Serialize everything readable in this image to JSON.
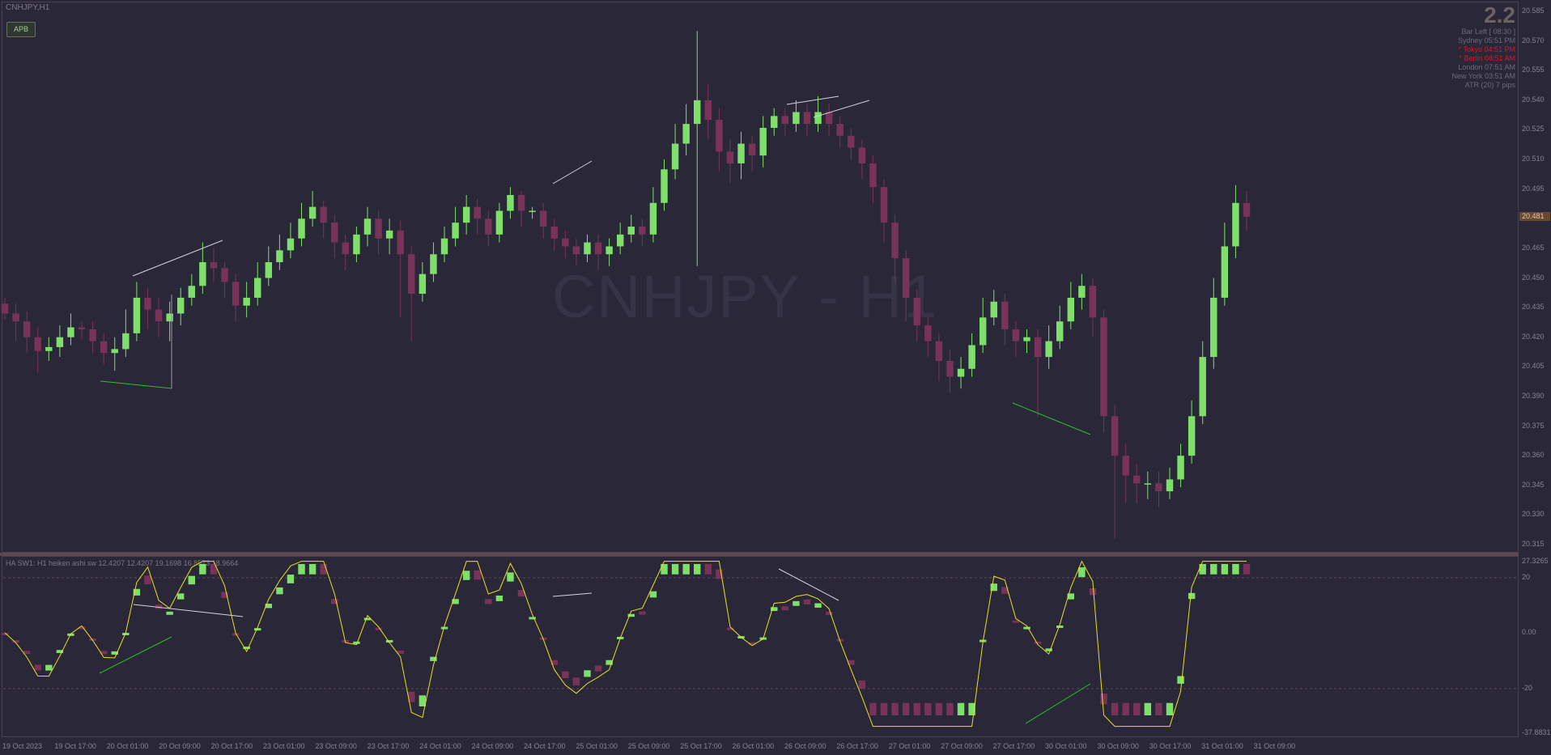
{
  "window": {
    "symbol_title": "CNHJPY,H1",
    "watermark": "CNHJPY - H1"
  },
  "buttons": {
    "apb_label": "APB"
  },
  "info_panel": {
    "spread": "2.2",
    "rows": [
      {
        "label": "Bar Left",
        "value": "[ 08:30 ]",
        "highlight": false
      },
      {
        "label": "Sydney",
        "value": "05:51 PM",
        "highlight": false
      },
      {
        "label": "* Tokyo",
        "value": "04:51 PM",
        "highlight": true
      },
      {
        "label": "* Berlin",
        "value": "08:51 AM",
        "highlight": true
      },
      {
        "label": "London",
        "value": "07:51 AM",
        "highlight": false
      },
      {
        "label": "New York",
        "value": "03:51 AM",
        "highlight": false
      },
      {
        "label": "ATR (20)",
        "value": "7 pips",
        "highlight": false
      }
    ]
  },
  "indicator": {
    "label": "HA SW1: H1 heiken ashi sw 12.4207 12.4207 19.1698 16.8573 18.9664"
  },
  "price_axis": {
    "ticks": [
      "20.585",
      "20.570",
      "20.555",
      "20.540",
      "20.525",
      "20.510",
      "20.495",
      "20.480",
      "20.465",
      "20.450",
      "20.435",
      "20.420",
      "20.405",
      "20.390",
      "20.375",
      "20.360",
      "20.345",
      "20.330",
      "20.315"
    ],
    "current": "20.481"
  },
  "indicator_axis": {
    "ticks": [
      "27.3265",
      "20",
      "0.00",
      "-20",
      "-37.8831"
    ]
  },
  "time_axis": {
    "ticks": [
      "19 Oct 2023",
      "19 Oct 17:00",
      "20 Oct 01:00",
      "20 Oct 09:00",
      "20 Oct 17:00",
      "23 Oct 01:00",
      "23 Oct 09:00",
      "23 Oct 17:00",
      "24 Oct 01:00",
      "24 Oct 09:00",
      "24 Oct 17:00",
      "25 Oct 01:00",
      "25 Oct 09:00",
      "25 Oct 17:00",
      "26 Oct 01:00",
      "26 Oct 09:00",
      "26 Oct 17:00",
      "27 Oct 01:00",
      "27 Oct 09:00",
      "27 Oct 17:00",
      "30 Oct 01:00",
      "30 Oct 09:00",
      "30 Oct 17:00",
      "31 Oct 01:00",
      "31 Oct 09:00"
    ]
  },
  "colors": {
    "background": "#2a2838",
    "bull": "#7ee06a",
    "bear": "#7a3358",
    "line": "#e8e020",
    "arrow_green": "#27c22a",
    "arrow_white": "#d6d2de"
  },
  "chart_data": {
    "type": "candlestick",
    "title": "CNHJPY - H1",
    "ylim": [
      20.315,
      20.585
    ],
    "candles": [
      {
        "o": 20.437,
        "c": 20.432,
        "h": 20.44,
        "l": 20.429
      },
      {
        "o": 20.432,
        "c": 20.428,
        "h": 20.437,
        "l": 20.418
      },
      {
        "o": 20.428,
        "c": 20.42,
        "h": 20.433,
        "l": 20.412
      },
      {
        "o": 20.42,
        "c": 20.413,
        "h": 20.425,
        "l": 20.402
      },
      {
        "o": 20.413,
        "c": 20.415,
        "h": 20.42,
        "l": 20.408
      },
      {
        "o": 20.415,
        "c": 20.42,
        "h": 20.426,
        "l": 20.41
      },
      {
        "o": 20.42,
        "c": 20.425,
        "h": 20.432,
        "l": 20.416
      },
      {
        "o": 20.425,
        "c": 20.424,
        "h": 20.428,
        "l": 20.419
      },
      {
        "o": 20.424,
        "c": 20.418,
        "h": 20.428,
        "l": 20.412
      },
      {
        "o": 20.418,
        "c": 20.412,
        "h": 20.422,
        "l": 20.406
      },
      {
        "o": 20.412,
        "c": 20.414,
        "h": 20.42,
        "l": 20.403
      },
      {
        "o": 20.414,
        "c": 20.422,
        "h": 20.434,
        "l": 20.41
      },
      {
        "o": 20.422,
        "c": 20.44,
        "h": 20.448,
        "l": 20.418
      },
      {
        "o": 20.44,
        "c": 20.434,
        "h": 20.445,
        "l": 20.424
      },
      {
        "o": 20.434,
        "c": 20.428,
        "h": 20.44,
        "l": 20.42
      },
      {
        "o": 20.428,
        "c": 20.432,
        "h": 20.438,
        "l": 20.418
      },
      {
        "o": 20.432,
        "c": 20.44,
        "h": 20.445,
        "l": 20.426
      },
      {
        "o": 20.44,
        "c": 20.446,
        "h": 20.452,
        "l": 20.436
      },
      {
        "o": 20.446,
        "c": 20.458,
        "h": 20.468,
        "l": 20.442
      },
      {
        "o": 20.458,
        "c": 20.455,
        "h": 20.465,
        "l": 20.448
      },
      {
        "o": 20.455,
        "c": 20.448,
        "h": 20.458,
        "l": 20.44
      },
      {
        "o": 20.448,
        "c": 20.436,
        "h": 20.452,
        "l": 20.428
      },
      {
        "o": 20.436,
        "c": 20.44,
        "h": 20.448,
        "l": 20.43
      },
      {
        "o": 20.44,
        "c": 20.45,
        "h": 20.458,
        "l": 20.436
      },
      {
        "o": 20.45,
        "c": 20.458,
        "h": 20.466,
        "l": 20.446
      },
      {
        "o": 20.458,
        "c": 20.464,
        "h": 20.472,
        "l": 20.454
      },
      {
        "o": 20.464,
        "c": 20.47,
        "h": 20.478,
        "l": 20.46
      },
      {
        "o": 20.47,
        "c": 20.48,
        "h": 20.488,
        "l": 20.466
      },
      {
        "o": 20.48,
        "c": 20.486,
        "h": 20.494,
        "l": 20.476
      },
      {
        "o": 20.486,
        "c": 20.478,
        "h": 20.489,
        "l": 20.47
      },
      {
        "o": 20.478,
        "c": 20.468,
        "h": 20.482,
        "l": 20.46
      },
      {
        "o": 20.468,
        "c": 20.462,
        "h": 20.472,
        "l": 20.454
      },
      {
        "o": 20.462,
        "c": 20.472,
        "h": 20.476,
        "l": 20.458
      },
      {
        "o": 20.472,
        "c": 20.48,
        "h": 20.486,
        "l": 20.466
      },
      {
        "o": 20.48,
        "c": 20.47,
        "h": 20.484,
        "l": 20.462
      },
      {
        "o": 20.47,
        "c": 20.474,
        "h": 20.48,
        "l": 20.462
      },
      {
        "o": 20.474,
        "c": 20.462,
        "h": 20.479,
        "l": 20.43
      },
      {
        "o": 20.462,
        "c": 20.442,
        "h": 20.466,
        "l": 20.418
      },
      {
        "o": 20.442,
        "c": 20.452,
        "h": 20.458,
        "l": 20.438
      },
      {
        "o": 20.452,
        "c": 20.462,
        "h": 20.468,
        "l": 20.448
      },
      {
        "o": 20.462,
        "c": 20.47,
        "h": 20.476,
        "l": 20.458
      },
      {
        "o": 20.47,
        "c": 20.478,
        "h": 20.486,
        "l": 20.466
      },
      {
        "o": 20.478,
        "c": 20.486,
        "h": 20.492,
        "l": 20.472
      },
      {
        "o": 20.486,
        "c": 20.48,
        "h": 20.49,
        "l": 20.472
      },
      {
        "o": 20.48,
        "c": 20.472,
        "h": 20.484,
        "l": 20.466
      },
      {
        "o": 20.472,
        "c": 20.484,
        "h": 20.488,
        "l": 20.468
      },
      {
        "o": 20.484,
        "c": 20.492,
        "h": 20.496,
        "l": 20.48
      },
      {
        "o": 20.492,
        "c": 20.484,
        "h": 20.494,
        "l": 20.476
      },
      {
        "o": 20.484,
        "c": 20.484,
        "h": 20.486,
        "l": 20.48
      },
      {
        "o": 20.484,
        "c": 20.476,
        "h": 20.488,
        "l": 20.47
      },
      {
        "o": 20.476,
        "c": 20.47,
        "h": 20.48,
        "l": 20.464
      },
      {
        "o": 20.47,
        "c": 20.466,
        "h": 20.474,
        "l": 20.46
      },
      {
        "o": 20.466,
        "c": 20.462,
        "h": 20.47,
        "l": 20.456
      },
      {
        "o": 20.462,
        "c": 20.468,
        "h": 20.472,
        "l": 20.458
      },
      {
        "o": 20.468,
        "c": 20.462,
        "h": 20.472,
        "l": 20.454
      },
      {
        "o": 20.462,
        "c": 20.466,
        "h": 20.47,
        "l": 20.456
      },
      {
        "o": 20.466,
        "c": 20.472,
        "h": 20.478,
        "l": 20.462
      },
      {
        "o": 20.472,
        "c": 20.476,
        "h": 20.482,
        "l": 20.468
      },
      {
        "o": 20.476,
        "c": 20.472,
        "h": 20.48,
        "l": 20.466
      },
      {
        "o": 20.472,
        "c": 20.488,
        "h": 20.496,
        "l": 20.468
      },
      {
        "o": 20.488,
        "c": 20.505,
        "h": 20.51,
        "l": 20.484
      },
      {
        "o": 20.505,
        "c": 20.518,
        "h": 20.528,
        "l": 20.5
      },
      {
        "o": 20.518,
        "c": 20.528,
        "h": 20.538,
        "l": 20.512
      },
      {
        "o": 20.528,
        "c": 20.54,
        "h": 20.575,
        "l": 20.456
      },
      {
        "o": 20.54,
        "c": 20.53,
        "h": 20.548,
        "l": 20.52
      },
      {
        "o": 20.53,
        "c": 20.514,
        "h": 20.536,
        "l": 20.504
      },
      {
        "o": 20.514,
        "c": 20.508,
        "h": 20.52,
        "l": 20.498
      },
      {
        "o": 20.508,
        "c": 20.518,
        "h": 20.524,
        "l": 20.5
      },
      {
        "o": 20.518,
        "c": 20.512,
        "h": 20.522,
        "l": 20.504
      },
      {
        "o": 20.512,
        "c": 20.526,
        "h": 20.532,
        "l": 20.506
      },
      {
        "o": 20.526,
        "c": 20.532,
        "h": 20.536,
        "l": 20.522
      },
      {
        "o": 20.532,
        "c": 20.528,
        "h": 20.536,
        "l": 20.522
      },
      {
        "o": 20.528,
        "c": 20.534,
        "h": 20.54,
        "l": 20.524
      },
      {
        "o": 20.534,
        "c": 20.528,
        "h": 20.538,
        "l": 20.522
      },
      {
        "o": 20.528,
        "c": 20.534,
        "h": 20.542,
        "l": 20.524
      },
      {
        "o": 20.534,
        "c": 20.528,
        "h": 20.538,
        "l": 20.522
      },
      {
        "o": 20.528,
        "c": 20.522,
        "h": 20.532,
        "l": 20.516
      },
      {
        "o": 20.522,
        "c": 20.516,
        "h": 20.526,
        "l": 20.51
      },
      {
        "o": 20.516,
        "c": 20.508,
        "h": 20.52,
        "l": 20.5
      },
      {
        "o": 20.508,
        "c": 20.496,
        "h": 20.512,
        "l": 20.488
      },
      {
        "o": 20.496,
        "c": 20.478,
        "h": 20.5,
        "l": 20.468
      },
      {
        "o": 20.478,
        "c": 20.46,
        "h": 20.482,
        "l": 20.448
      },
      {
        "o": 20.46,
        "c": 20.44,
        "h": 20.464,
        "l": 20.428
      },
      {
        "o": 20.44,
        "c": 20.426,
        "h": 20.444,
        "l": 20.418
      },
      {
        "o": 20.426,
        "c": 20.418,
        "h": 20.43,
        "l": 20.41
      },
      {
        "o": 20.418,
        "c": 20.408,
        "h": 20.422,
        "l": 20.398
      },
      {
        "o": 20.408,
        "c": 20.4,
        "h": 20.414,
        "l": 20.392
      },
      {
        "o": 20.4,
        "c": 20.404,
        "h": 20.41,
        "l": 20.394
      },
      {
        "o": 20.404,
        "c": 20.416,
        "h": 20.422,
        "l": 20.4
      },
      {
        "o": 20.416,
        "c": 20.43,
        "h": 20.44,
        "l": 20.412
      },
      {
        "o": 20.43,
        "c": 20.438,
        "h": 20.444,
        "l": 20.426
      },
      {
        "o": 20.438,
        "c": 20.424,
        "h": 20.442,
        "l": 20.416
      },
      {
        "o": 20.424,
        "c": 20.418,
        "h": 20.428,
        "l": 20.41
      },
      {
        "o": 20.418,
        "c": 20.42,
        "h": 20.424,
        "l": 20.412
      },
      {
        "o": 20.42,
        "c": 20.41,
        "h": 20.424,
        "l": 20.38
      },
      {
        "o": 20.41,
        "c": 20.418,
        "h": 20.426,
        "l": 20.404
      },
      {
        "o": 20.418,
        "c": 20.428,
        "h": 20.436,
        "l": 20.414
      },
      {
        "o": 20.428,
        "c": 20.44,
        "h": 20.448,
        "l": 20.424
      },
      {
        "o": 20.44,
        "c": 20.446,
        "h": 20.452,
        "l": 20.434
      },
      {
        "o": 20.446,
        "c": 20.43,
        "h": 20.45,
        "l": 20.42
      },
      {
        "o": 20.43,
        "c": 20.38,
        "h": 20.434,
        "l": 20.372
      },
      {
        "o": 20.38,
        "c": 20.36,
        "h": 20.386,
        "l": 20.318
      },
      {
        "o": 20.36,
        "c": 20.35,
        "h": 20.366,
        "l": 20.336
      },
      {
        "o": 20.35,
        "c": 20.346,
        "h": 20.356,
        "l": 20.336
      },
      {
        "o": 20.346,
        "c": 20.346,
        "h": 20.352,
        "l": 20.338
      },
      {
        "o": 20.346,
        "c": 20.342,
        "h": 20.352,
        "l": 20.334
      },
      {
        "o": 20.342,
        "c": 20.348,
        "h": 20.354,
        "l": 20.338
      },
      {
        "o": 20.348,
        "c": 20.36,
        "h": 20.366,
        "l": 20.344
      },
      {
        "o": 20.36,
        "c": 20.38,
        "h": 20.388,
        "l": 20.356
      },
      {
        "o": 20.38,
        "c": 20.41,
        "h": 20.418,
        "l": 20.376
      },
      {
        "o": 20.41,
        "c": 20.44,
        "h": 20.45,
        "l": 20.404
      },
      {
        "o": 20.44,
        "c": 20.466,
        "h": 20.478,
        "l": 20.436
      },
      {
        "o": 20.466,
        "c": 20.488,
        "h": 20.497,
        "l": 20.46
      },
      {
        "o": 20.488,
        "c": 20.481,
        "h": 20.494,
        "l": 20.474
      }
    ]
  }
}
